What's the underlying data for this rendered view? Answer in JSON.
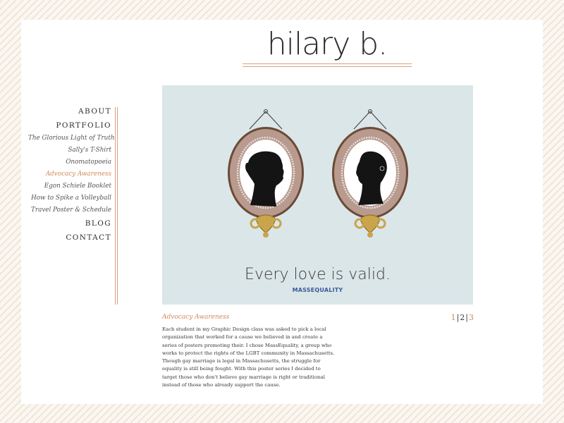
{
  "site": {
    "title": "hilary b."
  },
  "nav": {
    "main_top": [
      {
        "label": "ABOUT"
      },
      {
        "label": "PORTFOLIO"
      }
    ],
    "portfolio_items": [
      {
        "label": "The Glorious Light of Truth",
        "active": false
      },
      {
        "label": "Sally's T-Shirt",
        "active": false
      },
      {
        "label": "Onomatopoeia",
        "active": false
      },
      {
        "label": "Advocacy Awareness",
        "active": true
      },
      {
        "label": "Egon Schiele Booklet",
        "active": false
      },
      {
        "label": "How to Spike a Volleyball",
        "active": false
      },
      {
        "label": "Travel Poster & Schedule",
        "active": false
      }
    ],
    "main_bottom": [
      {
        "label": "BLOG"
      },
      {
        "label": "CONTACT"
      }
    ]
  },
  "poster": {
    "tagline": "Every love is valid.",
    "logo_text": "MASSEQUALITY"
  },
  "caption": {
    "title": "Advocacy Awareness",
    "pages": [
      "1",
      "2",
      "3"
    ],
    "current_page": "1",
    "description": "Each student in my Graphic Design class was asked to pick a local organization that worked for a cause we believed in and create a series of posters promoting their. I chose MassEquality, a group who works to protect the rights of the LGBT community in Massachusetts. Though gay marriage is legal in Massachusetts, the struggle for equality is still being fought. With this poster series I decided to target those who don't believe gay marriage is right or traditional instead of those who already support the cause."
  },
  "colors": {
    "accent": "#d38a58",
    "rule": "#d9a27c",
    "poster_bg": "#dbe6e9",
    "frame": "#b8988a",
    "gold": "#c9a44a"
  }
}
